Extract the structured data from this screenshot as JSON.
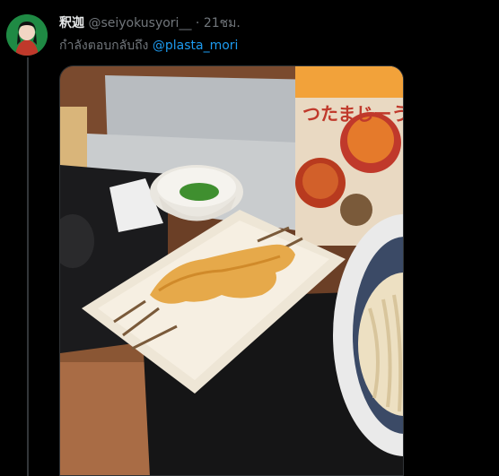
{
  "tweet": {
    "display_name": "釈迦",
    "handle": "@seiyokusyori__",
    "separator": "·",
    "time": "21ชม.",
    "reply_prefix": "กำลังตอบกลับถึง",
    "reply_to": "@plasta_mori"
  },
  "photo": {
    "poster_text": "つたまじーうどん"
  },
  "colors": {
    "background": "#000000",
    "link": "#1d9bf0",
    "muted_text": "#71767b"
  }
}
